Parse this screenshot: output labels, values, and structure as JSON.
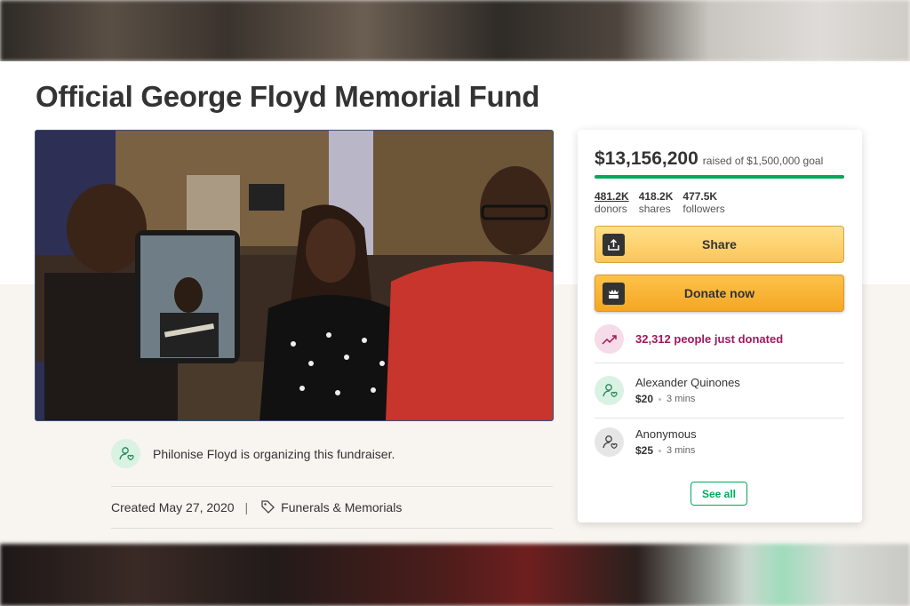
{
  "campaign": {
    "title": "Official George Floyd Memorial Fund",
    "organizer_text": "Philonise Floyd is organizing this fundraiser.",
    "created": "Created May 27, 2020",
    "category": "Funerals & Memorials"
  },
  "card": {
    "raised_amount": "$13,156,200",
    "goal_text": "raised of $1,500,000 goal",
    "progress_fraction": 1.0,
    "stats": [
      {
        "value": "481.2K",
        "label": "donors"
      },
      {
        "value": "418.2K",
        "label": "shares"
      },
      {
        "value": "477.5K",
        "label": "followers"
      }
    ],
    "share_label": "Share",
    "donate_label": "Donate now",
    "trending_text": "32,312 people just donated",
    "donations": [
      {
        "name": "Alexander Quinones",
        "amount": "$20",
        "time": "3 mins"
      },
      {
        "name": "Anonymous",
        "amount": "$25",
        "time": "3 mins"
      }
    ],
    "see_all_label": "See all"
  },
  "icons": {
    "share": "upload-icon",
    "donate": "gofundme-logo-icon",
    "trending": "trend-up-icon",
    "organizer": "user-heart-icon",
    "category": "tag-icon"
  },
  "colors": {
    "brand_green": "#02a95c",
    "trend_magenta": "#a0185d",
    "button_orange": "#f5a623"
  }
}
